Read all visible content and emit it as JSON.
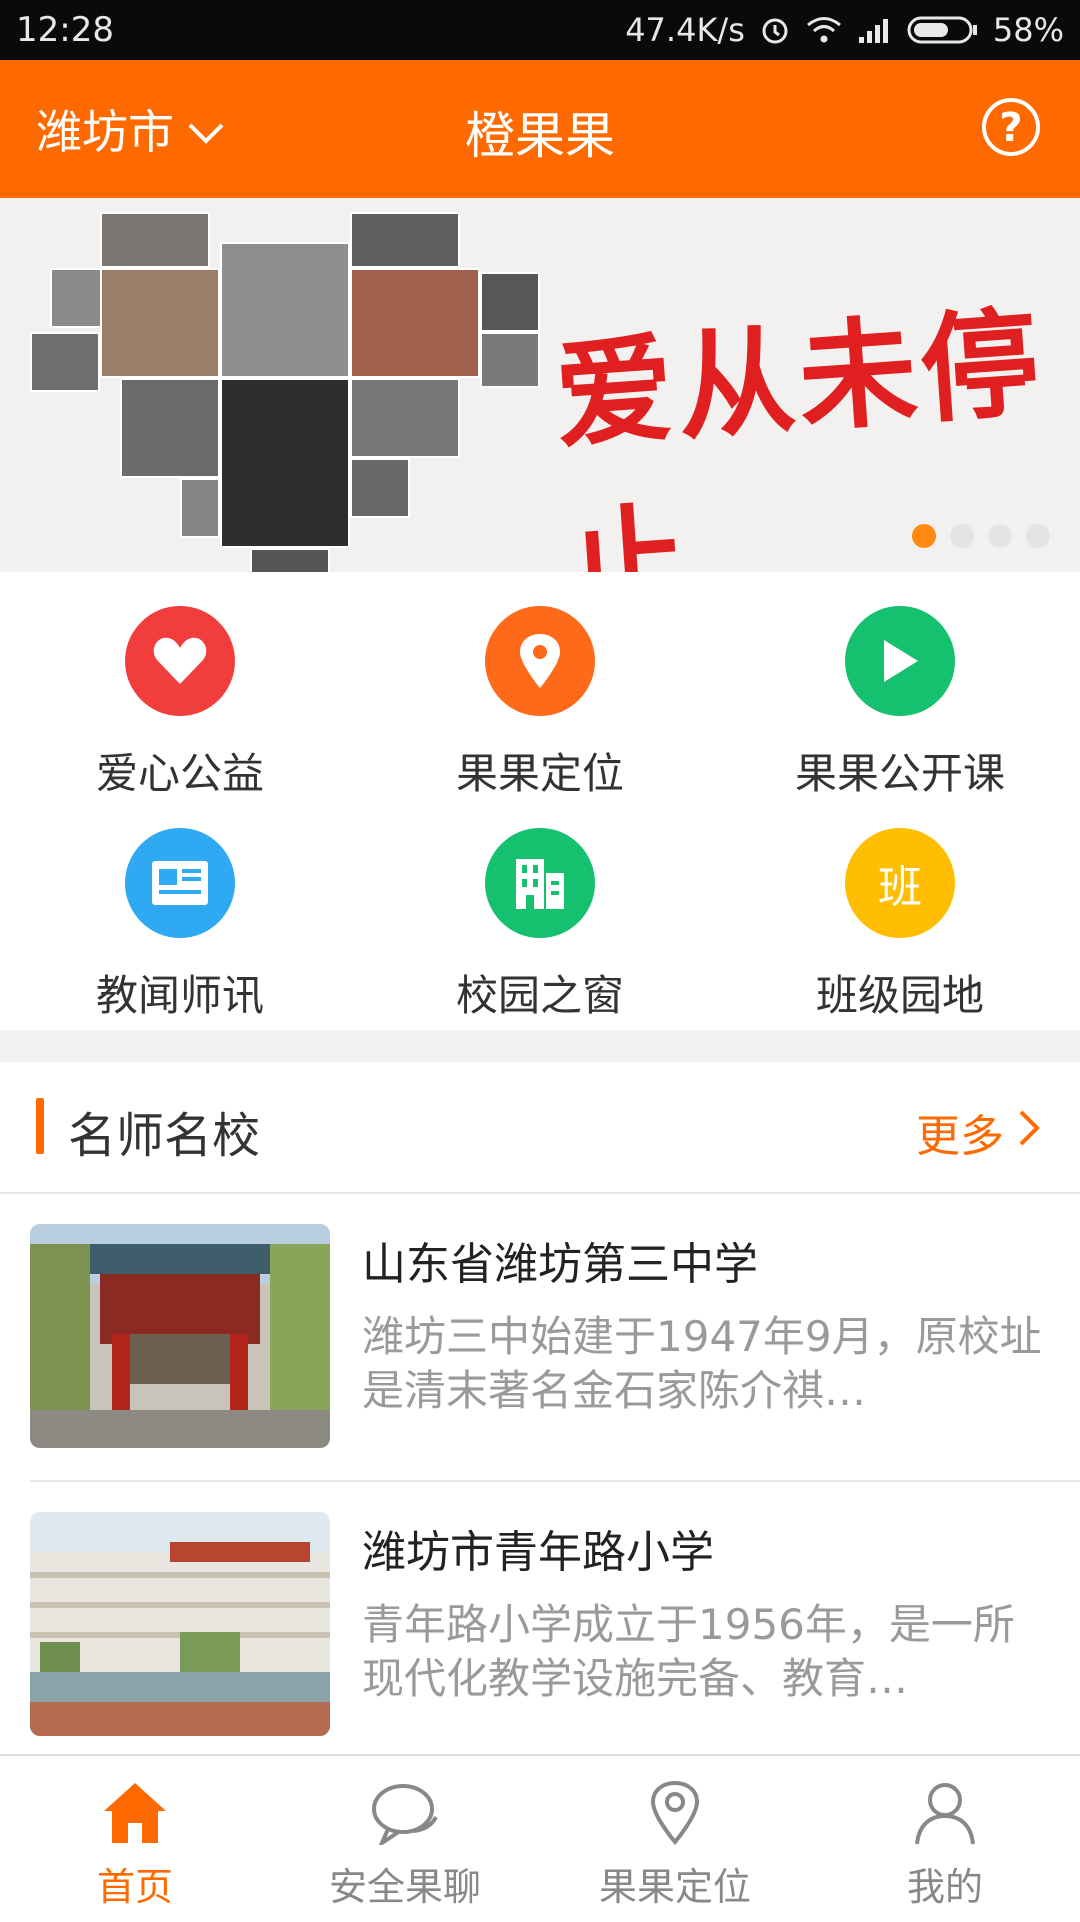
{
  "status_bar": {
    "time": "12:28",
    "speed": "47.4K/s",
    "battery": "58%"
  },
  "header": {
    "city": "潍坊市",
    "title": "橙果果",
    "help_icon": "?"
  },
  "banner": {
    "slogan": "爱从未停止",
    "dots": 4,
    "active_dot": 0
  },
  "menu": {
    "items": [
      {
        "label": "爱心公益",
        "icon": "heart-icon",
        "color": "#f23d3d"
      },
      {
        "label": "果果定位",
        "icon": "location-pin-icon",
        "color": "#ff6a1a"
      },
      {
        "label": "果果公开课",
        "icon": "play-icon",
        "color": "#15c06e"
      },
      {
        "label": "教闻师讯",
        "icon": "news-icon",
        "color": "#2ea9f2"
      },
      {
        "label": "校园之窗",
        "icon": "building-icon",
        "color": "#15c06e"
      },
      {
        "label": "班级园地",
        "icon": "class-icon",
        "glyph": "班",
        "color": "#ffbf00"
      }
    ]
  },
  "section": {
    "title": "名师名校",
    "more": "更多",
    "schools": [
      {
        "name": "山东省潍坊第三中学",
        "desc": "潍坊三中始建于1947年9月，原校址是清末著名金石家陈介祺…"
      },
      {
        "name": "潍坊市青年路小学",
        "desc": "青年路小学成立于1956年，是一所现代化教学设施完备、教育…"
      }
    ]
  },
  "tabs": [
    {
      "label": "首页",
      "icon": "home-icon",
      "active": true
    },
    {
      "label": "安全果聊",
      "icon": "chat-icon",
      "active": false
    },
    {
      "label": "果果定位",
      "icon": "location-pin-icon",
      "active": false
    },
    {
      "label": "我的",
      "icon": "person-icon",
      "active": false
    }
  ],
  "colors": {
    "accent": "#ff6a00",
    "inactive": "#888888"
  }
}
